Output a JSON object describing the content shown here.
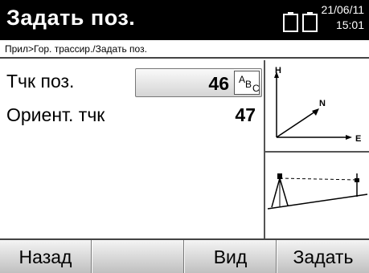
{
  "header": {
    "title": "Задать поз.",
    "date": "21/06/11",
    "time": "15:01"
  },
  "breadcrumb": "Прил>Гор. трассир./Задать поз.",
  "fields": {
    "position_point_label": "Тчк поз.",
    "position_point_value": "46",
    "orientation_point_label": "Ориент. тчк",
    "orientation_point_value": "47",
    "abc_a": "A",
    "abc_b": "B",
    "abc_c": "C"
  },
  "axes_diagram": {
    "axis_h": "H",
    "axis_n": "N",
    "axis_e": "E"
  },
  "softkeys": {
    "back": "Назад",
    "empty": "",
    "view": "Вид",
    "set": "Задать"
  }
}
